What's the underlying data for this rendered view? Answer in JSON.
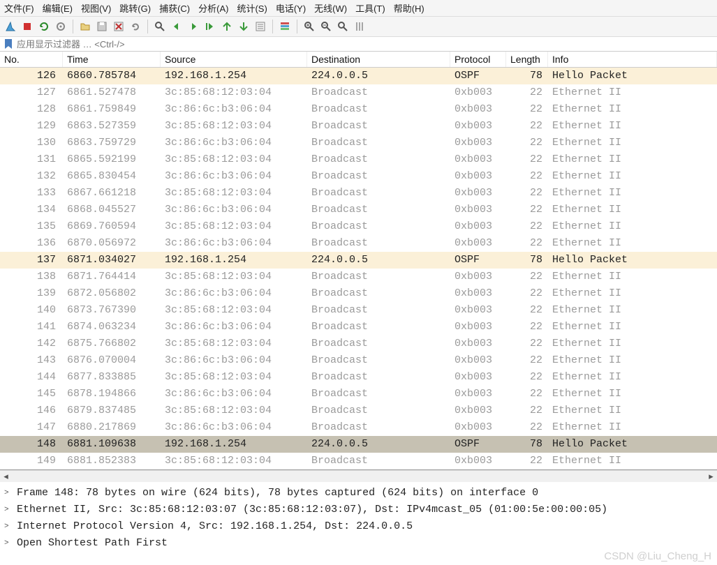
{
  "menubar": {
    "items": [
      "文件(F)",
      "编辑(E)",
      "视图(V)",
      "跳转(G)",
      "捕获(C)",
      "分析(A)",
      "统计(S)",
      "电话(Y)",
      "无线(W)",
      "工具(T)",
      "帮助(H)"
    ]
  },
  "toolbar": {
    "icons": [
      "shark-fin-icon",
      "stop-icon",
      "restart-icon",
      "options-icon",
      "open-icon",
      "save-icon",
      "close-file-icon",
      "reload-icon",
      "find-icon",
      "back-icon",
      "forward-icon",
      "goto-packet-icon",
      "first-icon",
      "last-icon",
      "auto-scroll-icon",
      "colorize-icon",
      "zoom-in-icon",
      "zoom-out-icon",
      "zoom-reset-icon",
      "resize-columns-icon"
    ]
  },
  "filter": {
    "placeholder": "应用显示过滤器 … <Ctrl-/>"
  },
  "columns": [
    "No.",
    "Time",
    "Source",
    "Destination",
    "Protocol",
    "Length",
    "Info"
  ],
  "packets": [
    {
      "no": "126",
      "time": "6860.785784",
      "src": "192.168.1.254",
      "dst": "224.0.0.5",
      "proto": "OSPF",
      "len": "78",
      "info": "Hello Packet",
      "style": "highlight"
    },
    {
      "no": "127",
      "time": "6861.527478",
      "src": "3c:85:68:12:03:04",
      "dst": "Broadcast",
      "proto": "0xb003",
      "len": "22",
      "info": "Ethernet II",
      "style": "normal"
    },
    {
      "no": "128",
      "time": "6861.759849",
      "src": "3c:86:6c:b3:06:04",
      "dst": "Broadcast",
      "proto": "0xb003",
      "len": "22",
      "info": "Ethernet II",
      "style": "normal"
    },
    {
      "no": "129",
      "time": "6863.527359",
      "src": "3c:85:68:12:03:04",
      "dst": "Broadcast",
      "proto": "0xb003",
      "len": "22",
      "info": "Ethernet II",
      "style": "normal"
    },
    {
      "no": "130",
      "time": "6863.759729",
      "src": "3c:86:6c:b3:06:04",
      "dst": "Broadcast",
      "proto": "0xb003",
      "len": "22",
      "info": "Ethernet II",
      "style": "normal"
    },
    {
      "no": "131",
      "time": "6865.592199",
      "src": "3c:85:68:12:03:04",
      "dst": "Broadcast",
      "proto": "0xb003",
      "len": "22",
      "info": "Ethernet II",
      "style": "normal"
    },
    {
      "no": "132",
      "time": "6865.830454",
      "src": "3c:86:6c:b3:06:04",
      "dst": "Broadcast",
      "proto": "0xb003",
      "len": "22",
      "info": "Ethernet II",
      "style": "normal"
    },
    {
      "no": "133",
      "time": "6867.661218",
      "src": "3c:85:68:12:03:04",
      "dst": "Broadcast",
      "proto": "0xb003",
      "len": "22",
      "info": "Ethernet II",
      "style": "normal"
    },
    {
      "no": "134",
      "time": "6868.045527",
      "src": "3c:86:6c:b3:06:04",
      "dst": "Broadcast",
      "proto": "0xb003",
      "len": "22",
      "info": "Ethernet II",
      "style": "normal"
    },
    {
      "no": "135",
      "time": "6869.760594",
      "src": "3c:85:68:12:03:04",
      "dst": "Broadcast",
      "proto": "0xb003",
      "len": "22",
      "info": "Ethernet II",
      "style": "normal"
    },
    {
      "no": "136",
      "time": "6870.056972",
      "src": "3c:86:6c:b3:06:04",
      "dst": "Broadcast",
      "proto": "0xb003",
      "len": "22",
      "info": "Ethernet II",
      "style": "normal"
    },
    {
      "no": "137",
      "time": "6871.034027",
      "src": "192.168.1.254",
      "dst": "224.0.0.5",
      "proto": "OSPF",
      "len": "78",
      "info": "Hello Packet",
      "style": "highlight"
    },
    {
      "no": "138",
      "time": "6871.764414",
      "src": "3c:85:68:12:03:04",
      "dst": "Broadcast",
      "proto": "0xb003",
      "len": "22",
      "info": "Ethernet II",
      "style": "normal"
    },
    {
      "no": "139",
      "time": "6872.056802",
      "src": "3c:86:6c:b3:06:04",
      "dst": "Broadcast",
      "proto": "0xb003",
      "len": "22",
      "info": "Ethernet II",
      "style": "normal"
    },
    {
      "no": "140",
      "time": "6873.767390",
      "src": "3c:85:68:12:03:04",
      "dst": "Broadcast",
      "proto": "0xb003",
      "len": "22",
      "info": "Ethernet II",
      "style": "normal"
    },
    {
      "no": "141",
      "time": "6874.063234",
      "src": "3c:86:6c:b3:06:04",
      "dst": "Broadcast",
      "proto": "0xb003",
      "len": "22",
      "info": "Ethernet II",
      "style": "normal"
    },
    {
      "no": "142",
      "time": "6875.766802",
      "src": "3c:85:68:12:03:04",
      "dst": "Broadcast",
      "proto": "0xb003",
      "len": "22",
      "info": "Ethernet II",
      "style": "normal"
    },
    {
      "no": "143",
      "time": "6876.070004",
      "src": "3c:86:6c:b3:06:04",
      "dst": "Broadcast",
      "proto": "0xb003",
      "len": "22",
      "info": "Ethernet II",
      "style": "normal"
    },
    {
      "no": "144",
      "time": "6877.833885",
      "src": "3c:85:68:12:03:04",
      "dst": "Broadcast",
      "proto": "0xb003",
      "len": "22",
      "info": "Ethernet II",
      "style": "normal"
    },
    {
      "no": "145",
      "time": "6878.194866",
      "src": "3c:86:6c:b3:06:04",
      "dst": "Broadcast",
      "proto": "0xb003",
      "len": "22",
      "info": "Ethernet II",
      "style": "normal"
    },
    {
      "no": "146",
      "time": "6879.837485",
      "src": "3c:85:68:12:03:04",
      "dst": "Broadcast",
      "proto": "0xb003",
      "len": "22",
      "info": "Ethernet II",
      "style": "normal"
    },
    {
      "no": "147",
      "time": "6880.217869",
      "src": "3c:86:6c:b3:06:04",
      "dst": "Broadcast",
      "proto": "0xb003",
      "len": "22",
      "info": "Ethernet II",
      "style": "normal"
    },
    {
      "no": "148",
      "time": "6881.109638",
      "src": "192.168.1.254",
      "dst": "224.0.0.5",
      "proto": "OSPF",
      "len": "78",
      "info": "Hello Packet",
      "style": "selected"
    },
    {
      "no": "149",
      "time": "6881.852383",
      "src": "3c:85:68:12:03:04",
      "dst": "Broadcast",
      "proto": "0xb003",
      "len": "22",
      "info": "Ethernet II",
      "style": "normal"
    }
  ],
  "details": [
    "Frame 148: 78 bytes on wire (624 bits), 78 bytes captured (624 bits) on interface 0",
    "Ethernet II, Src: 3c:85:68:12:03:07 (3c:85:68:12:03:07), Dst: IPv4mcast_05 (01:00:5e:00:00:05)",
    "Internet Protocol Version 4, Src: 192.168.1.254, Dst: 224.0.0.5",
    "Open Shortest Path First"
  ],
  "watermark": "CSDN @Liu_Cheng_H"
}
